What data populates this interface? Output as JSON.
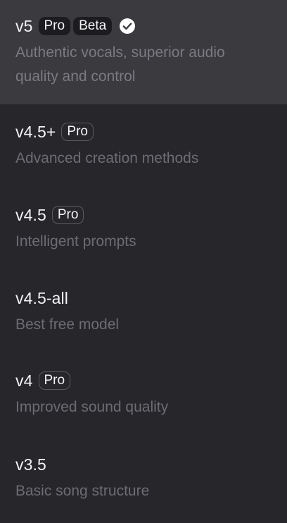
{
  "models": [
    {
      "name": "v5",
      "badges": [
        "Pro",
        "Beta"
      ],
      "description": "Authentic vocals, superior audio quality and control",
      "selected": true
    },
    {
      "name": "v4.5+",
      "badges": [
        "Pro"
      ],
      "description": "Advanced creation methods",
      "selected": false
    },
    {
      "name": "v4.5",
      "badges": [
        "Pro"
      ],
      "description": "Intelligent prompts",
      "selected": false
    },
    {
      "name": "v4.5-all",
      "badges": [],
      "description": "Best free model",
      "selected": false
    },
    {
      "name": "v4",
      "badges": [
        "Pro"
      ],
      "description": "Improved sound quality",
      "selected": false
    },
    {
      "name": "v3.5",
      "badges": [],
      "description": "Basic song structure",
      "selected": false
    }
  ],
  "icons": {
    "selected_indicator": "check-circle-icon"
  },
  "colors": {
    "background": "#26262b",
    "selected_background": "#3a3a3f",
    "title_text": "#f4f4f5",
    "description_text": "#6c6c72"
  }
}
